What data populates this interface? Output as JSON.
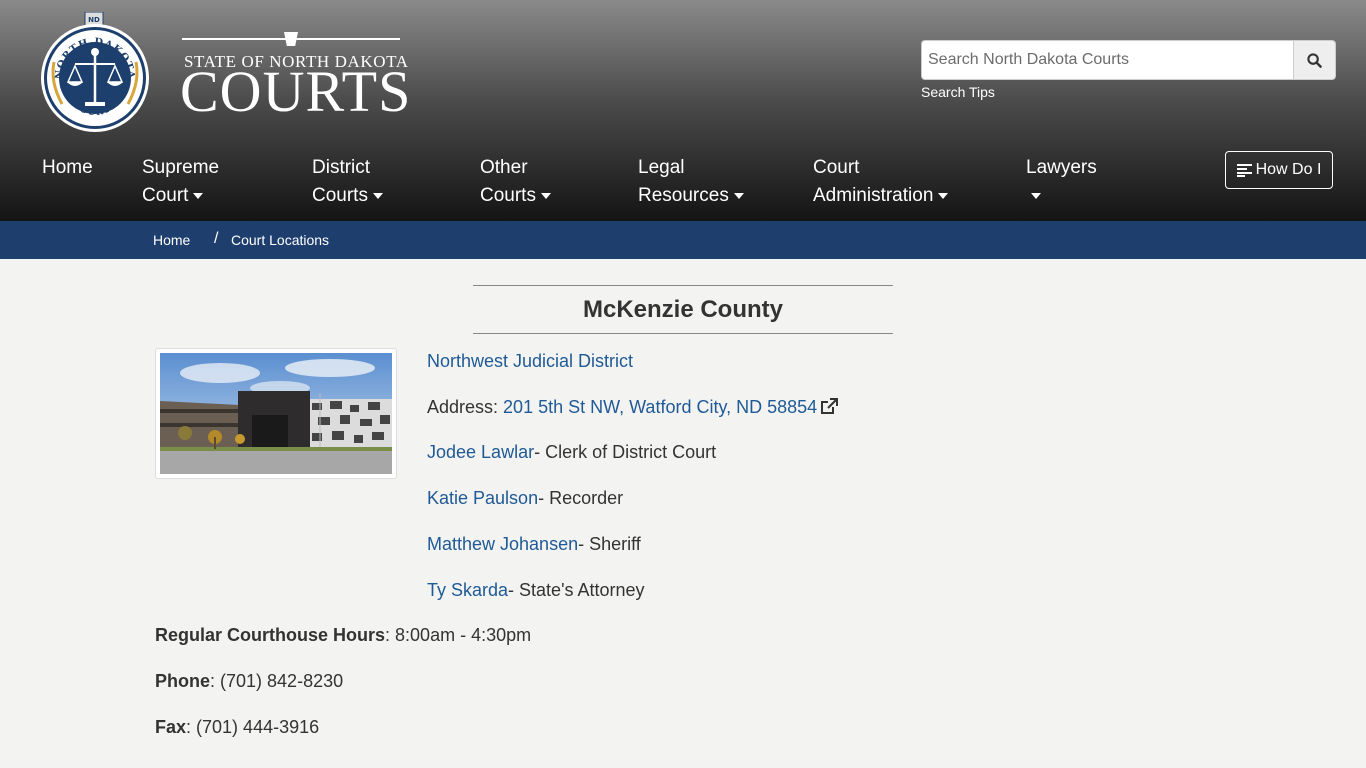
{
  "header": {
    "title_small": "STATE OF NORTH DAKOTA",
    "title_big": "COURTS",
    "seal_top": "NORTH DAKOTA",
    "seal_bottom": "COURTS",
    "seal_tag": "ND",
    "search_placeholder": "Search North Dakota Courts",
    "search_tips": "Search Tips"
  },
  "nav": {
    "home": "Home",
    "supreme_1": "Supreme",
    "supreme_2": "Court",
    "district_1": "District",
    "district_2": "Courts",
    "other_1": "Other",
    "other_2": "Courts",
    "legal_1": "Legal",
    "legal_2": "Resources",
    "admin_1": "Court",
    "admin_2": "Administration",
    "lawyers": "Lawyers",
    "how_do_i": "How Do I"
  },
  "breadcrumb": {
    "home": "Home",
    "current": "Court Locations"
  },
  "county": {
    "name": "McKenzie County",
    "district": "Northwest Judicial District",
    "address_label": "Address: ",
    "address": "201 5th St NW, Watford City, ND 58854",
    "contacts": [
      {
        "name": "Jodee Lawlar",
        "role": "- Clerk of District Court"
      },
      {
        "name": "Katie Paulson",
        "role": "- Recorder"
      },
      {
        "name": "Matthew Johansen",
        "role": "- Sheriff"
      },
      {
        "name": "Ty Skarda",
        "role": "- State's Attorney"
      }
    ],
    "hours_label": "Regular Courthouse Hours",
    "hours": ": 8:00am - 4:30pm",
    "phone_label": "Phone",
    "phone": ": (701) 842-8230",
    "fax_label": "Fax",
    "fax": ": (701) 444-3916"
  },
  "colors": {
    "link": "#1f5a96",
    "breadcrumb_bg": "#1e3f6e",
    "seal_blue": "#1d3f6d"
  }
}
